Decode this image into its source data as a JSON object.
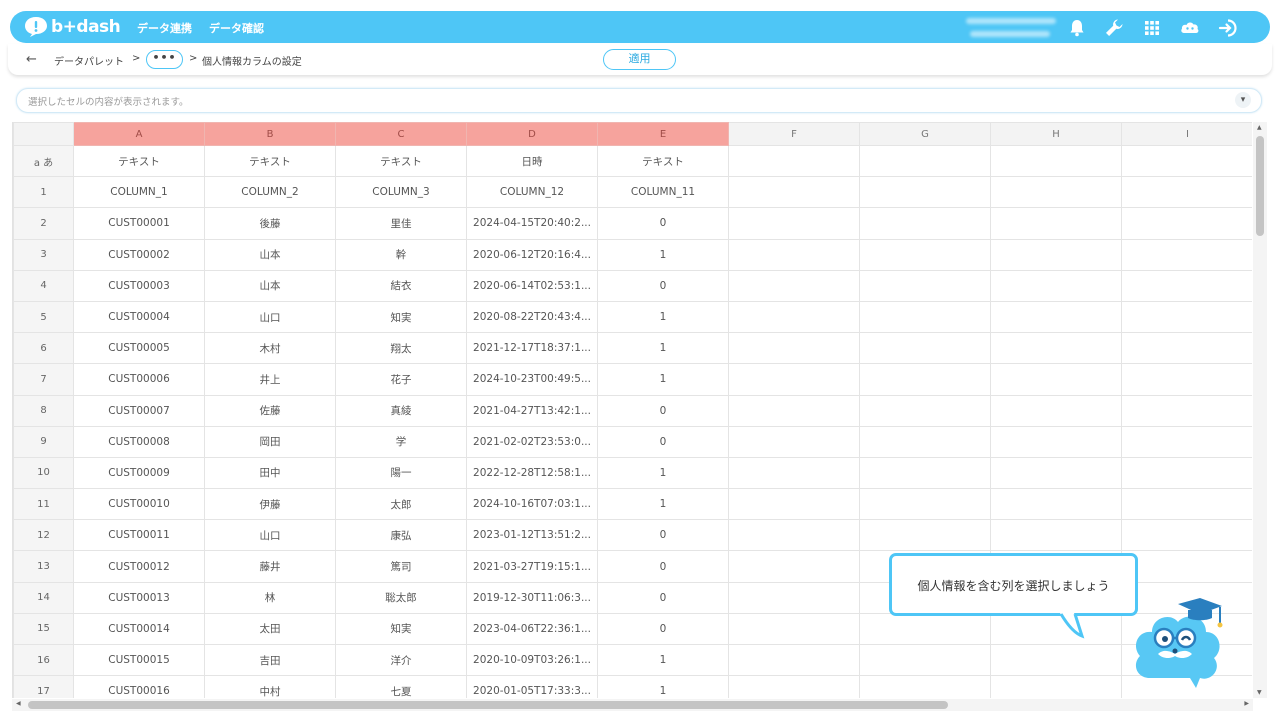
{
  "app": {
    "logo_text": "b+dash"
  },
  "nav": {
    "items": [
      {
        "label": "データ連携"
      },
      {
        "label": "データ確認"
      }
    ]
  },
  "breadcrumb": {
    "items": [
      "データパレット",
      "個人情報カラムの設定"
    ],
    "sep": ">",
    "ellipsis": "•••"
  },
  "toolbar": {
    "apply_label": "適用"
  },
  "cell_display": {
    "placeholder": "選択したセルの内容が表示されます。"
  },
  "grid": {
    "columns": [
      "A",
      "B",
      "C",
      "D",
      "E",
      "F",
      "G",
      "H",
      "I"
    ],
    "type_row_label": "a あ",
    "types": [
      "テキスト",
      "テキスト",
      "テキスト",
      "日時",
      "テキスト",
      "",
      "",
      "",
      ""
    ],
    "headers": [
      "COLUMN_1",
      "COLUMN_2",
      "COLUMN_3",
      "COLUMN_12",
      "COLUMN_11",
      "",
      "",
      "",
      ""
    ],
    "rows": [
      [
        "2",
        "CUST00001",
        "後藤",
        "里佳",
        "2024-04-15T20:40:2...",
        "0"
      ],
      [
        "3",
        "CUST00002",
        "山本",
        "幹",
        "2020-06-12T20:16:4...",
        "1"
      ],
      [
        "4",
        "CUST00003",
        "山本",
        "結衣",
        "2020-06-14T02:53:1...",
        "0"
      ],
      [
        "5",
        "CUST00004",
        "山口",
        "知実",
        "2020-08-22T20:43:4...",
        "1"
      ],
      [
        "6",
        "CUST00005",
        "木村",
        "翔太",
        "2021-12-17T18:37:1...",
        "1"
      ],
      [
        "7",
        "CUST00006",
        "井上",
        "花子",
        "2024-10-23T00:49:5...",
        "1"
      ],
      [
        "8",
        "CUST00007",
        "佐藤",
        "真綾",
        "2021-04-27T13:42:1...",
        "0"
      ],
      [
        "9",
        "CUST00008",
        "岡田",
        "学",
        "2021-02-02T23:53:0...",
        "0"
      ],
      [
        "10",
        "CUST00009",
        "田中",
        "陽一",
        "2022-12-28T12:58:1...",
        "1"
      ],
      [
        "11",
        "CUST00010",
        "伊藤",
        "太郎",
        "2024-10-16T07:03:1...",
        "1"
      ],
      [
        "12",
        "CUST00011",
        "山口",
        "康弘",
        "2023-01-12T13:51:2...",
        "0"
      ],
      [
        "13",
        "CUST00012",
        "藤井",
        "篤司",
        "2021-03-27T19:15:1...",
        "0"
      ],
      [
        "14",
        "CUST00013",
        "林",
        "聡太郎",
        "2019-12-30T11:06:3...",
        "0"
      ],
      [
        "15",
        "CUST00014",
        "太田",
        "知実",
        "2023-04-06T22:36:1...",
        "0"
      ],
      [
        "16",
        "CUST00015",
        "吉田",
        "洋介",
        "2020-10-09T03:26:1...",
        "1"
      ],
      [
        "17",
        "CUST00016",
        "中村",
        "七夏",
        "2020-01-05T17:33:3...",
        "1"
      ]
    ],
    "selected_columns": [
      "A",
      "B",
      "C",
      "D",
      "E"
    ],
    "selected_color": "#f6a39d"
  },
  "tooltip": {
    "text": "個人情報を含む列を選択しましょう"
  },
  "colors": {
    "accent": "#4ec6f6",
    "selected_header": "#f6a39d"
  },
  "icons": [
    "back-arrow-icon",
    "bell-icon",
    "wrench-icon",
    "grid-menu-icon",
    "user-cloud-icon",
    "logout-icon",
    "chevron-down-icon",
    "mascot-icon"
  ]
}
